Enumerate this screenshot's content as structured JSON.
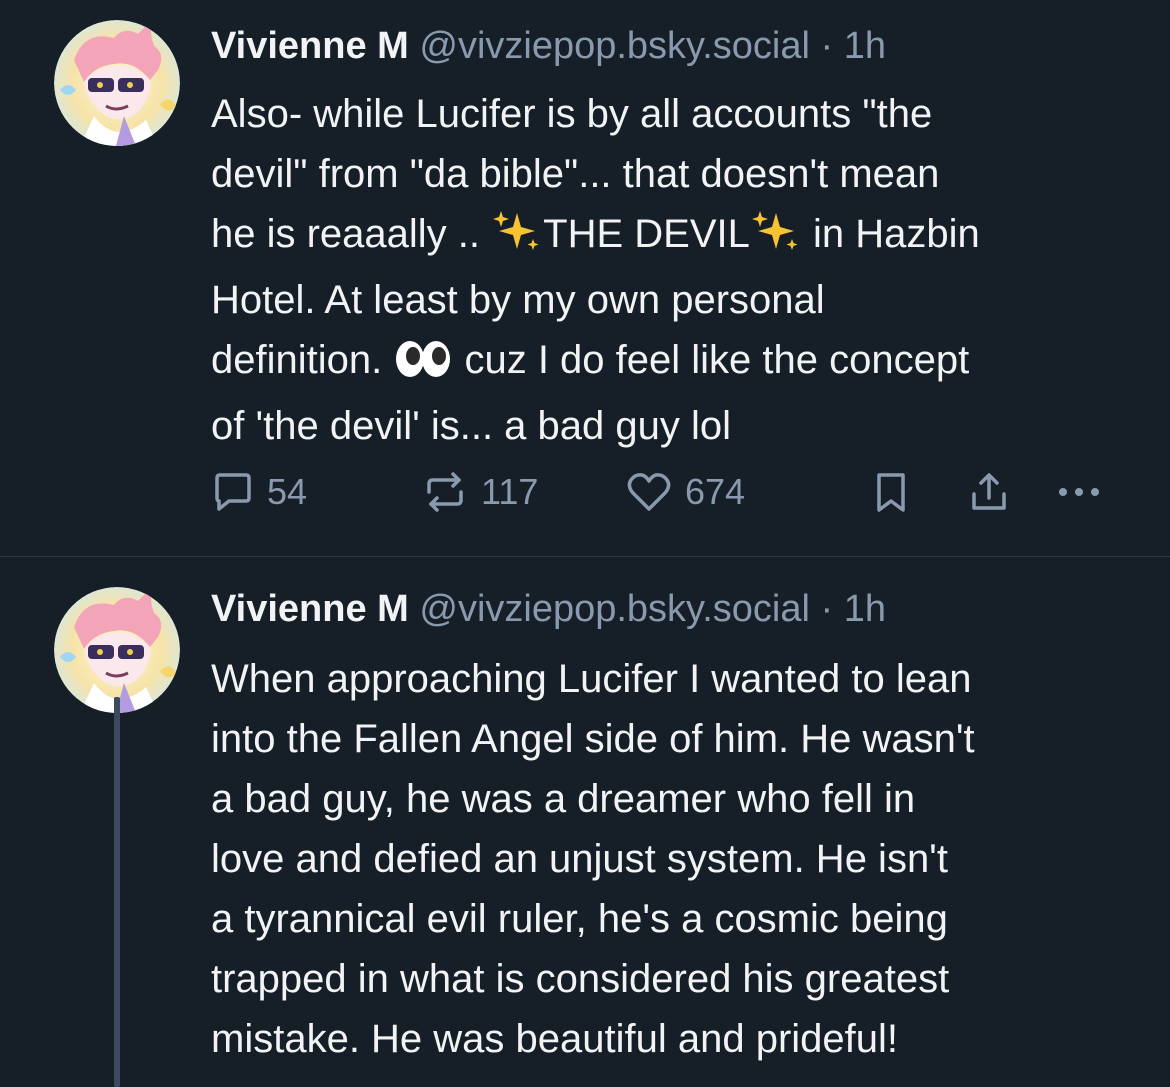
{
  "posts": [
    {
      "author": "Vivienne M",
      "handle": "@vivziepop.bsky.social",
      "separator": "·",
      "time": "1h",
      "lines": [
        [
          "Also- while Lucifer is by all accounts \"the"
        ],
        [
          "devil\" from \"da bible\"... that doesn't mean"
        ],
        [
          "he is reaaally .. ",
          "THE DEVIL",
          " in Hazbin"
        ],
        [
          "Hotel. At least by my own personal"
        ],
        [
          "definition. ",
          " cuz I do feel like the concept"
        ],
        [
          "of 'the devil' is... a bad guy lol"
        ]
      ],
      "actions": {
        "replies": "54",
        "reposts": "117",
        "likes": "674"
      }
    },
    {
      "author": "Vivienne M",
      "handle": "@vivziepop.bsky.social",
      "separator": "·",
      "time": "1h",
      "lines": [
        "When approaching Lucifer I wanted to lean",
        "into the Fallen Angel side of him. He wasn't",
        "a bad guy, he was a dreamer who fell in",
        "love and defied an unjust system. He isn't",
        "a tyrannical evil ruler, he's a cosmic being",
        "trapped in what is considered his greatest",
        "mistake. He was beautiful and prideful!"
      ]
    }
  ],
  "icons": {
    "reply": "speech-bubble-icon",
    "repost": "repost-arrows-icon",
    "like": "heart-icon",
    "bookmark": "bookmark-icon",
    "share": "share-upload-icon",
    "more": "more-dots-icon",
    "sparkles": "sparkles-emoji",
    "eyes": "eyes-emoji"
  },
  "colors": {
    "background": "#161e27",
    "text": "#f1f3f5",
    "muted": "#8a9aae",
    "thread_line": "#3b4a5c"
  }
}
